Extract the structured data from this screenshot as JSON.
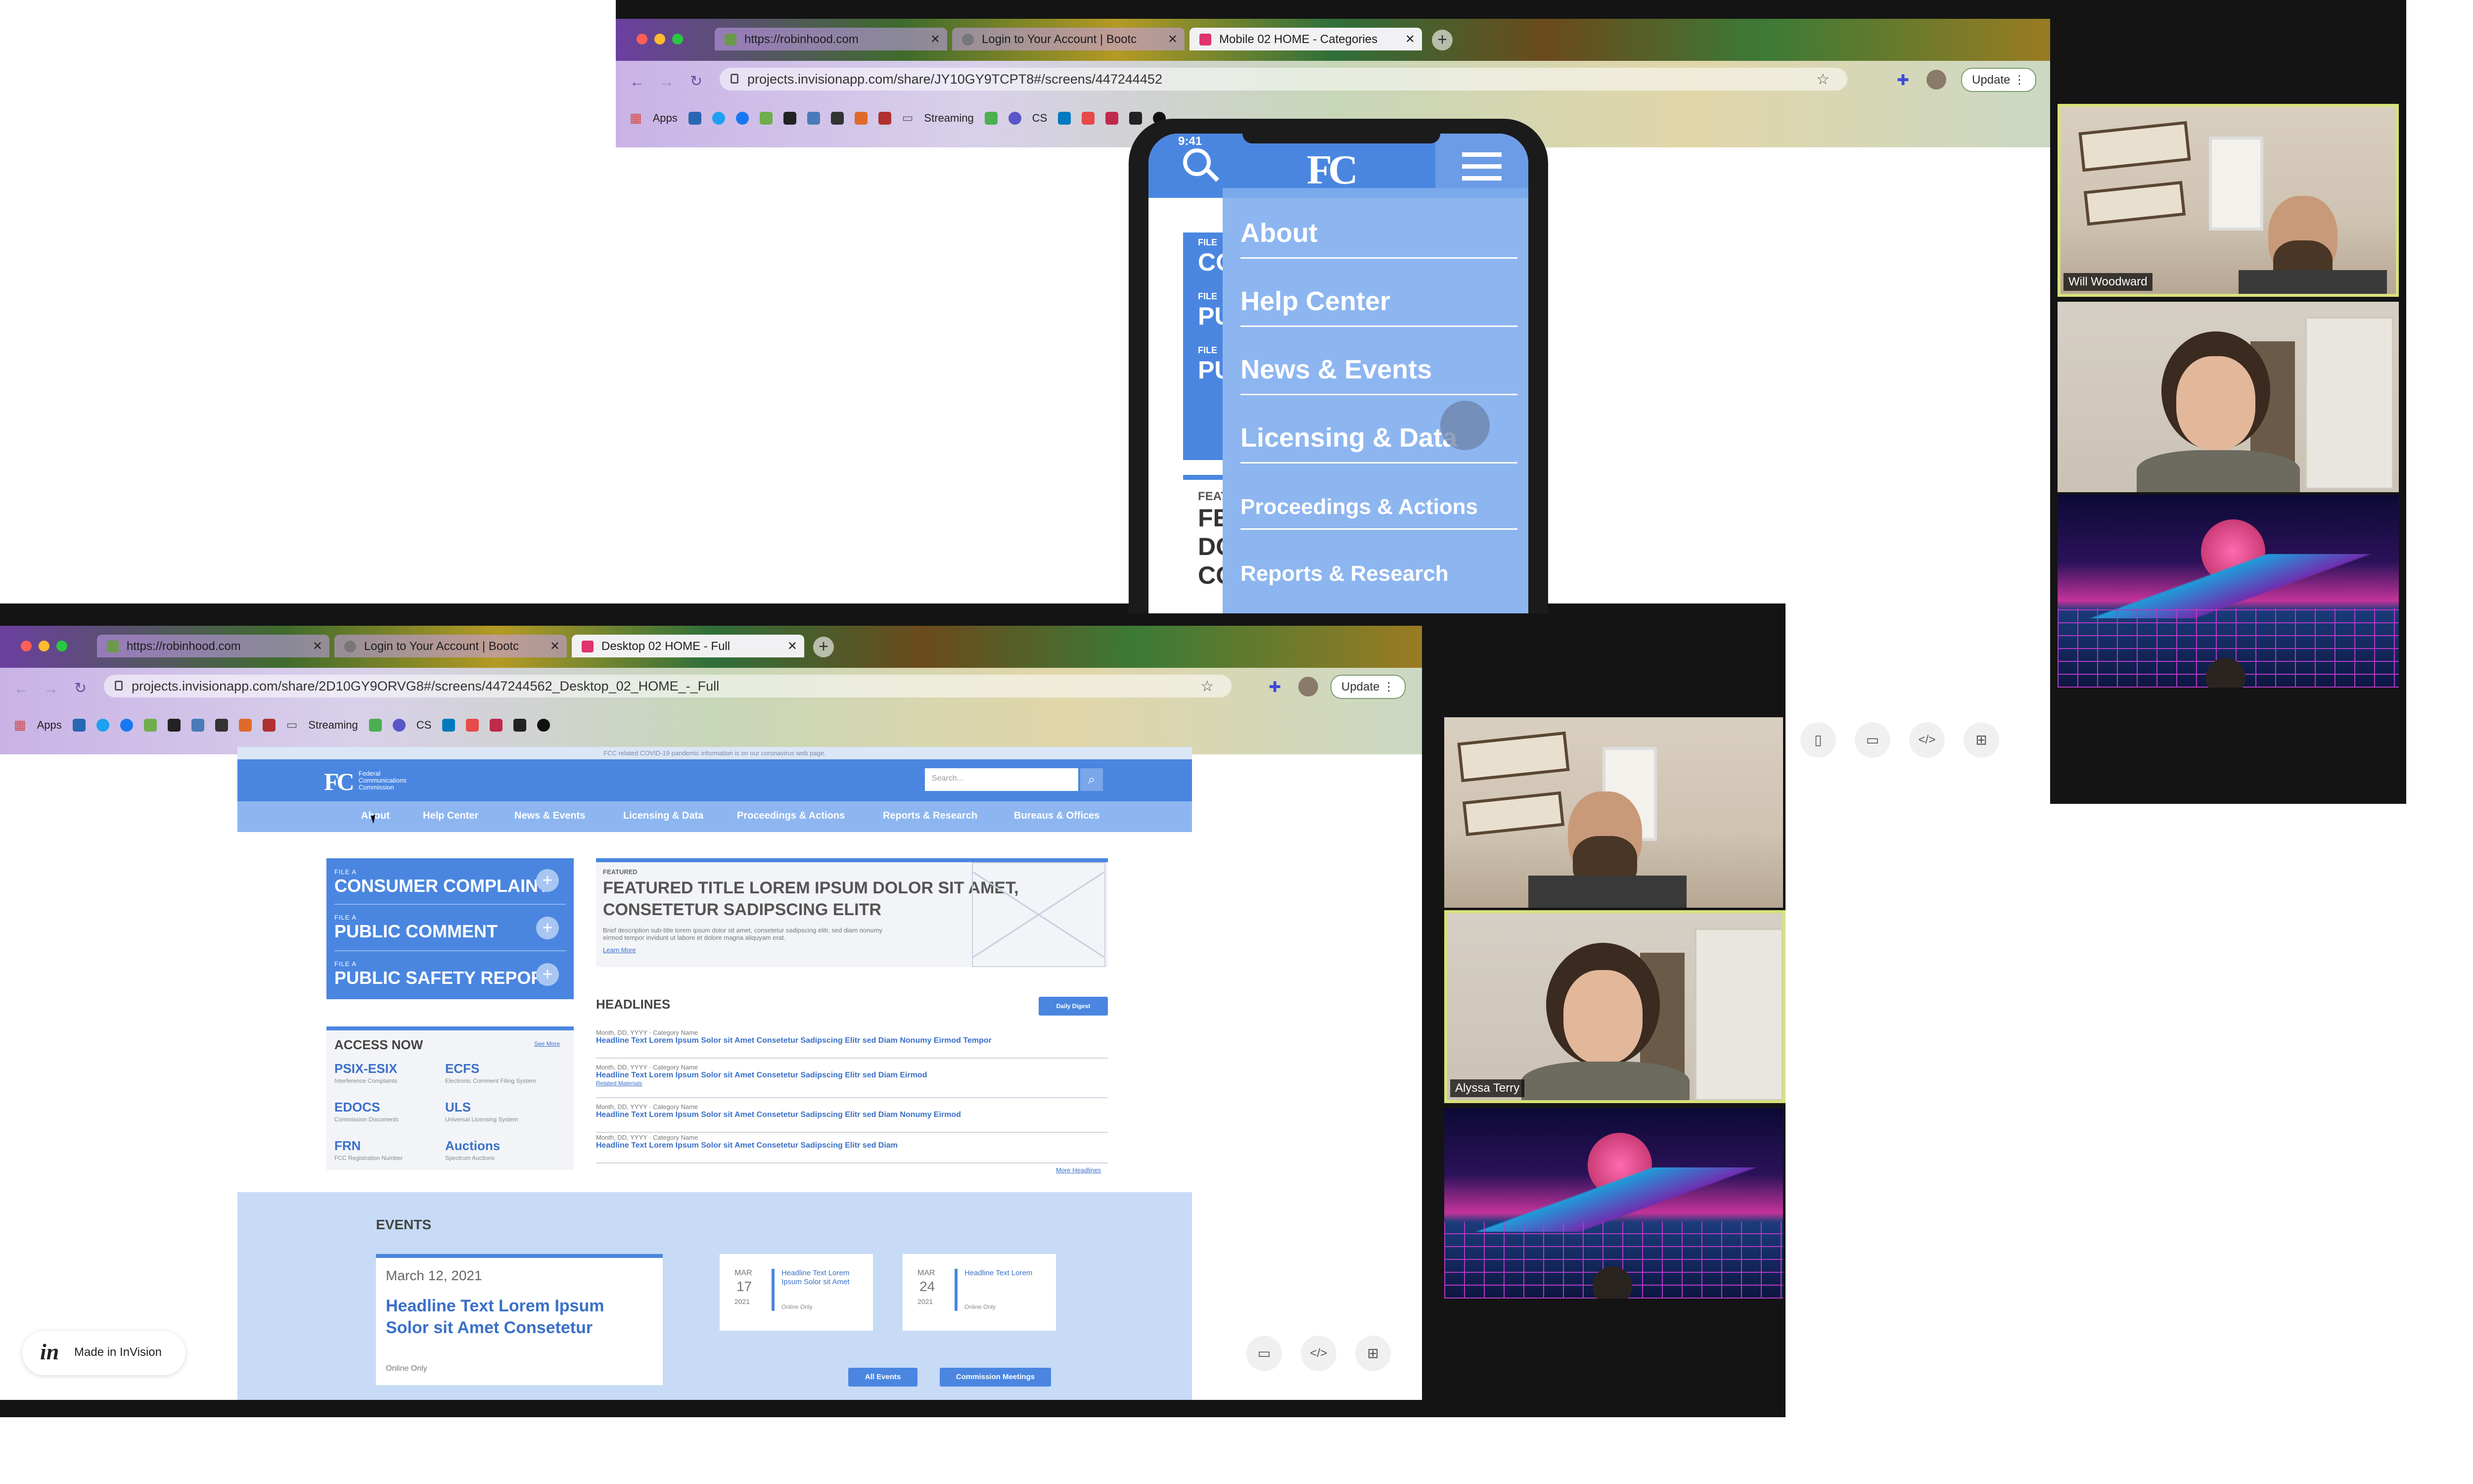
{
  "top_browser": {
    "tabs": [
      {
        "title": "https://robinhood.com"
      },
      {
        "title": "Login to Your Account | Bootc"
      },
      {
        "title": "Mobile 02 HOME - Categories"
      }
    ],
    "url": "projects.invisionapp.com/share/JY10GY9TCPT8#/screens/447244452",
    "update_label": "Update",
    "bookmarks": {
      "apps": "Apps",
      "streaming": "Streaming",
      "cs": "CS"
    }
  },
  "mobile": {
    "time": "9:41",
    "menu_items": [
      {
        "label": "About"
      },
      {
        "label": "Help Center"
      },
      {
        "label": "News & Events"
      },
      {
        "label": "Licensing & Data"
      },
      {
        "label": "Proceedings & Actions"
      },
      {
        "label": "Reports & Research"
      }
    ],
    "behind_text": [
      "FILE",
      "CO",
      "FILE",
      "PU",
      "FILE",
      "PU",
      "FEAT",
      "FEA",
      "DO",
      "COI"
    ]
  },
  "bottom_browser": {
    "tabs": [
      {
        "title": "https://robinhood.com"
      },
      {
        "title": "Login to Your Account | Bootc"
      },
      {
        "title": "Desktop 02 HOME - Full"
      }
    ],
    "url": "projects.invisionapp.com/share/2D10GY9ORVG8#/screens/447244562_Desktop_02_HOME_-_Full",
    "update_label": "Update",
    "bookmarks": {
      "apps": "Apps",
      "streaming": "Streaming",
      "cs": "CS"
    }
  },
  "desktop": {
    "banner": "FCC related COVID-19 pandemic information is on our coronavirus web page.",
    "logo": {
      "mark": "FC",
      "line1": "Federal",
      "line2": "Communications",
      "line3": "Commission"
    },
    "search_placeholder": "Search...",
    "nav": [
      {
        "label": "About"
      },
      {
        "label": "Help Center"
      },
      {
        "label": "News & Events"
      },
      {
        "label": "Licensing & Data"
      },
      {
        "label": "Proceedings & Actions"
      },
      {
        "label": "Reports & Research"
      },
      {
        "label": "Bureaus & Offices"
      }
    ],
    "file_items": [
      {
        "small": "FILE A",
        "big": "CONSUMER COMPLAINT"
      },
      {
        "small": "FILE A",
        "big": "PUBLIC COMMENT"
      },
      {
        "small": "FILE A",
        "big": "PUBLIC SAFETY REPORT"
      }
    ],
    "featured": {
      "eyebrow": "FEATURED",
      "title_line1": "FEATURED TITLE LOREM IPSUM DOLOR SIT AMET,",
      "title_line2": "CONSETETUR SADIPSCING ELITR",
      "desc_line1": "Brief description sub-title lorem ipsum dolor sit amet, consetetur sadipscing elitr, sed diam nonumy",
      "desc_line2": "eirmod tempor invidunt ut labore et dolore magna aliquyam erat.",
      "learn_more": "Learn More"
    },
    "headlines": {
      "title": "HEADLINES",
      "digest_button": "Daily Digest",
      "items": [
        {
          "meta": "Month, DD, YYYY · Category Name",
          "text": "Headline Text Lorem Ipsum Solor sit Amet Consetetur Sadipscing Elitr sed Diam Nonumy Eirmod Tempor",
          "extra": ""
        },
        {
          "meta": "Month, DD, YYYY · Category Name",
          "text": "Headline Text Lorem Ipsum Solor sit Amet Consetetur Sadipscing Elitr sed Diam Eirmod",
          "extra": "Related Materials"
        },
        {
          "meta": "Month, DD, YYYY · Category Name",
          "text": "Headline Text Lorem Ipsum Solor sit Amet Consetetur Sadipscing Elitr sed Diam Nonumy Eirmod",
          "extra": ""
        },
        {
          "meta": "Month, DD, YYYY · Category Name",
          "text": "Headline Text Lorem Ipsum Solor sit Amet Consetetur Sadipscing Elitr sed Diam",
          "extra": ""
        }
      ],
      "more": "More Headlines"
    },
    "access": {
      "title": "ACCESS NOW",
      "see_more": "See More",
      "items": [
        {
          "name": "PSIX-ESIX",
          "desc": "Interference Complaints"
        },
        {
          "name": "ECFS",
          "desc": "Electronic Comment Filing System"
        },
        {
          "name": "EDOCS",
          "desc": "Commission Documents"
        },
        {
          "name": "ULS",
          "desc": "Universal Licensing System"
        },
        {
          "name": "FRN",
          "desc": "FCC Registration Number"
        },
        {
          "name": "Auctions",
          "desc": "Spectrum Auctions"
        }
      ]
    },
    "events": {
      "title": "EVENTS",
      "main": {
        "date": "March 12, 2021",
        "headline_line1": "Headline Text Lorem Ipsum",
        "headline_line2": "Solor sit Amet Consetetur",
        "location": "Online Only"
      },
      "small": [
        {
          "month": "MAR",
          "day": "17",
          "year": "2021",
          "headline_line1": "Headline Text Lorem",
          "headline_line2": "Ipsum Solor sit Amet",
          "location": "Online Only"
        },
        {
          "month": "MAR",
          "day": "24",
          "year": "2021",
          "headline_line1": "Headline Text Lorem",
          "headline_line2": "",
          "location": "Online Only"
        }
      ],
      "all_events": "All Events",
      "commission_meetings": "Commission Meetings"
    }
  },
  "invision_badge": {
    "logo": "in",
    "label": "Made in InVision"
  },
  "participants": [
    {
      "name": "Will Woodward"
    },
    {
      "name": "Alyssa Terry"
    }
  ],
  "colors": {
    "fcc_blue": "#4a86e0",
    "fcc_light": "#8db6f0",
    "active_speaker": "#d8e27a"
  },
  "icons": [
    "search-icon",
    "hamburger-icon",
    "star-icon",
    "extension-icon",
    "reload-icon",
    "comment-icon",
    "code-icon",
    "grid-icon",
    "mobile-icon"
  ]
}
